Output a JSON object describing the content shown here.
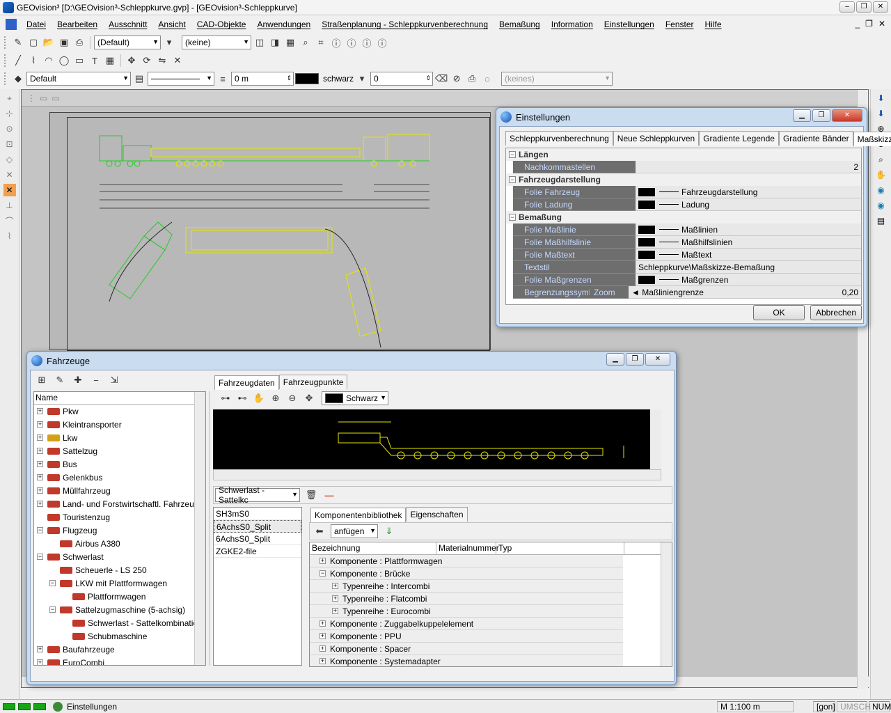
{
  "window": {
    "title": "GEOvision³  [D:\\GEOvision³-Schleppkurve.gvp]  -  [GEOvision³-Schleppkurve]",
    "controls": [
      "–",
      "❐",
      "✕"
    ]
  },
  "menu": {
    "items": [
      "Datei",
      "Bearbeiten",
      "Ausschnitt",
      "Ansicht",
      "CAD-Objekte",
      "Anwendungen",
      "Straßenplanung - Schleppkurvenberechnung",
      "Bemaßung",
      "Information",
      "Einstellungen",
      "Fenster",
      "Hilfe"
    ],
    "mdi_controls": [
      "_",
      "❐",
      "✕"
    ]
  },
  "toolbar1": {
    "style_combo": "(Default)",
    "layer_combo": "(keine)"
  },
  "toolbar3": {
    "layer_combo": "Default",
    "distance": "0 m",
    "color_label": "schwarz",
    "value": "0",
    "disabled_combo": "(keines)"
  },
  "einstellungen": {
    "title": "Einstellungen",
    "tabs": [
      "Schleppkurvenberechnung",
      "Neue Schleppkurven",
      "Gradiente Legende",
      "Gradiente Bänder",
      "Maßskizze"
    ],
    "active_tab": "Maßskizze",
    "categories": [
      {
        "name": "Längen",
        "rows": [
          {
            "label": "Nachkommastellen",
            "value": "2",
            "align": "right"
          }
        ]
      },
      {
        "name": "Fahrzeugdarstellung",
        "rows": [
          {
            "label": "Folie Fahrzeug",
            "value": "Fahrzeugdarstellung",
            "swatch": true
          },
          {
            "label": "Folie Ladung",
            "value": "Ladung",
            "swatch": true
          }
        ]
      },
      {
        "name": "Bemaßung",
        "rows": [
          {
            "label": "Folie Maßlinie",
            "value": "Maßlinien",
            "swatch": true
          },
          {
            "label": "Folie Maßhilfslinie",
            "value": "Maßhilfslinien",
            "swatch": true
          },
          {
            "label": "Folie Maßtext",
            "value": "Maßtext",
            "swatch": true
          },
          {
            "label": "Textstil",
            "value": "Schleppkurve\\Maßskizze-Bemaßung"
          },
          {
            "label": "Folie Maßgrenzen",
            "value": "Maßgrenzen",
            "swatch": true
          }
        ]
      }
    ],
    "last_row": {
      "label": "Begrenzungssymbol",
      "zoom": "Zoom",
      "value": "◄ Maßliniengrenze",
      "number": "0,20"
    },
    "ok": "OK",
    "cancel": "Abbrechen"
  },
  "fahrzeuge": {
    "title": "Fahrzeuge",
    "tree_header": "Name",
    "tree": [
      {
        "label": "Pkw",
        "level": 0,
        "pm": "+",
        "color": "#c0392b"
      },
      {
        "label": "Kleintransporter",
        "level": 0,
        "pm": "+",
        "color": "#c0392b"
      },
      {
        "label": "Lkw",
        "level": 0,
        "pm": "+",
        "color": "#d4a017"
      },
      {
        "label": "Sattelzug",
        "level": 0,
        "pm": "+",
        "color": "#c0392b"
      },
      {
        "label": "Bus",
        "level": 0,
        "pm": "+",
        "color": "#c0392b"
      },
      {
        "label": "Gelenkbus",
        "level": 0,
        "pm": "+",
        "color": "#c0392b"
      },
      {
        "label": "Müllfahrzeug",
        "level": 0,
        "pm": "+",
        "color": "#c0392b"
      },
      {
        "label": "Land- und Forstwirtschaftl. Fahrzeuge",
        "level": 0,
        "pm": "+",
        "color": "#c0392b"
      },
      {
        "label": "Touristenzug",
        "level": 0,
        "pm": "",
        "color": "#c0392b"
      },
      {
        "label": "Flugzeug",
        "level": 0,
        "pm": "−",
        "color": "#c0392b"
      },
      {
        "label": "Airbus A380",
        "level": 1,
        "pm": "",
        "color": "#c0392b"
      },
      {
        "label": "Schwerlast",
        "level": 0,
        "pm": "−",
        "color": "#c0392b"
      },
      {
        "label": "Scheuerle - LS 250",
        "level": 1,
        "pm": "",
        "color": "#c0392b"
      },
      {
        "label": "LKW mit Plattformwagen",
        "level": 1,
        "pm": "−",
        "color": "#c0392b"
      },
      {
        "label": "Plattformwagen",
        "level": 2,
        "pm": "",
        "color": "#c0392b"
      },
      {
        "label": "Sattelzugmaschine (5-achsig)",
        "level": 1,
        "pm": "−",
        "color": "#c0392b"
      },
      {
        "label": "Schwerlast - Sattelkombination",
        "level": 2,
        "pm": "",
        "color": "#c0392b"
      },
      {
        "label": "Schubmaschine",
        "level": 2,
        "pm": "",
        "color": "#c0392b"
      },
      {
        "label": "Baufahrzeuge",
        "level": 0,
        "pm": "+",
        "color": "#c0392b"
      },
      {
        "label": "EuroCombi",
        "level": 0,
        "pm": "+",
        "color": "#c0392b"
      }
    ],
    "tabs": [
      "Fahrzeugdaten",
      "Fahrzeugpunkte"
    ],
    "color_combo": "Schwarz",
    "vehicle_combo": "Schwerlast - Sattelkc",
    "vehicle_list": [
      "SH3mS0",
      "6AchsS0_Split",
      "6AchsS0_Split",
      "ZGKE2-file"
    ],
    "vehicle_list_selected": 1,
    "sub_tabs": [
      "Komponentenbibliothek",
      "Eigenschaften"
    ],
    "append_combo": "anfügen",
    "grid_headers": [
      "Bezeichnung",
      "Materialnummer",
      "Typ"
    ],
    "grid_rows": [
      {
        "label": "Komponente : Plattformwagen",
        "indent": 0,
        "pm": "+"
      },
      {
        "label": "Komponente : Brücke",
        "indent": 0,
        "pm": "−"
      },
      {
        "label": "Typenreihe : Intercombi",
        "indent": 1,
        "pm": "+"
      },
      {
        "label": "Typenreihe : Flatcombi",
        "indent": 1,
        "pm": "+"
      },
      {
        "label": "Typenreihe : Eurocombi",
        "indent": 1,
        "pm": "+"
      },
      {
        "label": "Komponente : Zuggabelkuppelelement",
        "indent": 0,
        "pm": "+"
      },
      {
        "label": "Komponente : PPU",
        "indent": 0,
        "pm": "+"
      },
      {
        "label": "Komponente : Spacer",
        "indent": 0,
        "pm": "+"
      },
      {
        "label": "Komponente : Systemadapter",
        "indent": 0,
        "pm": "+"
      }
    ]
  },
  "status": {
    "text": "Einstellungen",
    "scale": "M 1:100  m",
    "gon": "[gon]",
    "umsch": "UMSCH",
    "num": "NUM"
  },
  "colors": {
    "vehicle_yellow": "#e6e600",
    "vehicle_green": "#22cc22",
    "dialog_frame": "#c9dcf0",
    "prop_name_bg": "#6e6e6e",
    "prop_name_text": "#c5d8ff"
  }
}
